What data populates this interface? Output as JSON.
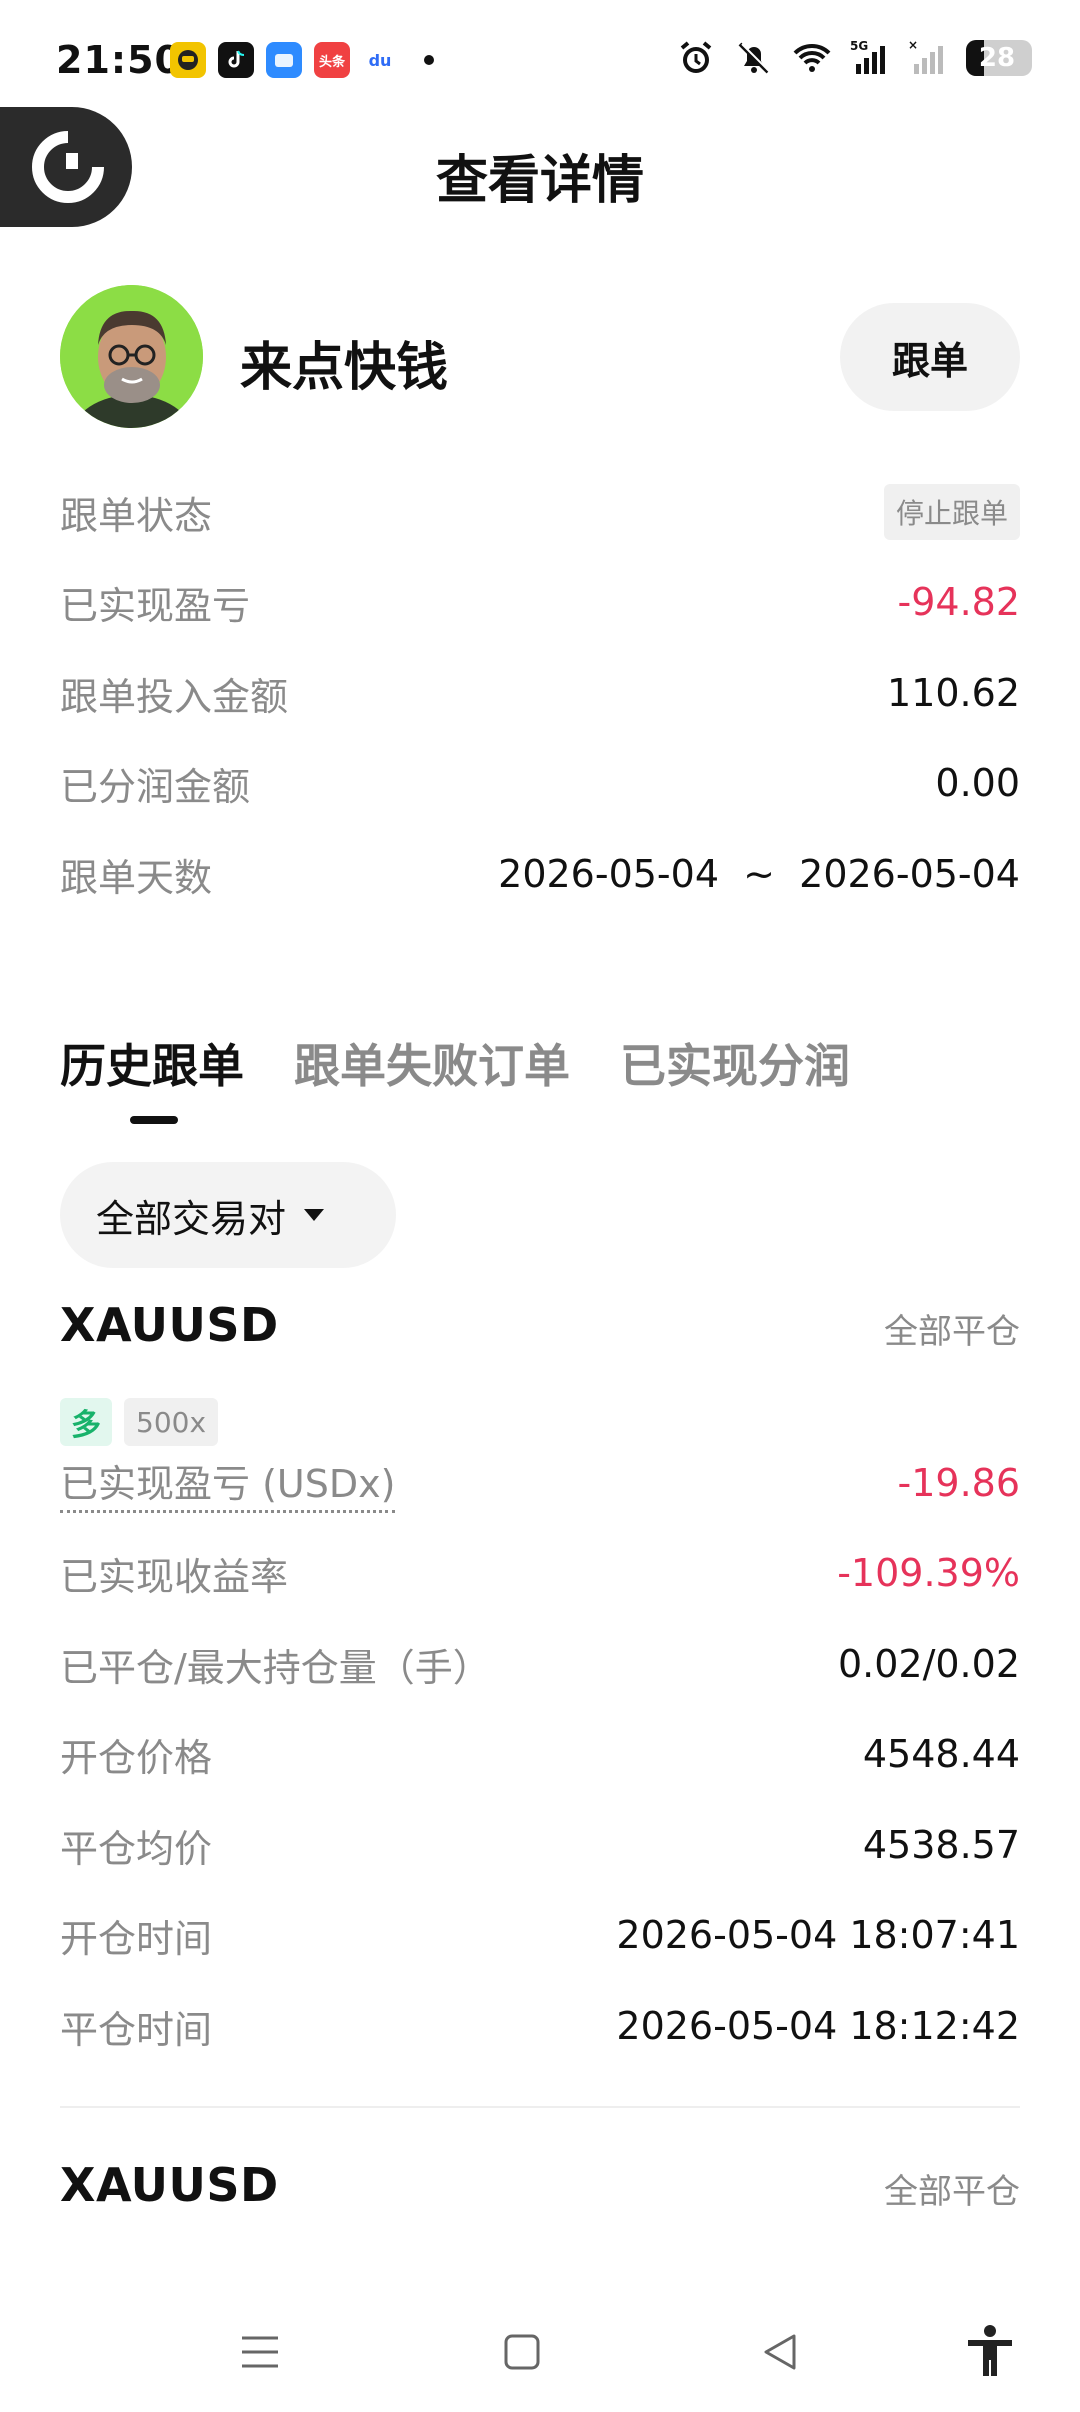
{
  "status_bar": {
    "time": "21:50",
    "battery": "28",
    "battery_level": 0.28,
    "network": "5G",
    "app_badges": [
      {
        "name": "taxi-app-icon",
        "text": "",
        "color": "#f2c400"
      },
      {
        "name": "tiktok-icon",
        "text": "",
        "color": "#111111"
      },
      {
        "name": "files-app-icon",
        "text": "",
        "color": "#2e8bff"
      },
      {
        "name": "toutiao-icon",
        "text": "头条",
        "color": "#f04142"
      },
      {
        "name": "baidu-icon",
        "text": "du",
        "color": "#2f6cf6"
      }
    ]
  },
  "header": {
    "title": "查看详情"
  },
  "profile": {
    "name": "来点快钱",
    "follow_button": "跟单"
  },
  "summary": [
    {
      "label": "跟单状态",
      "value": "停止跟单",
      "type": "tag"
    },
    {
      "label": "已实现盈亏",
      "value": "-94.82",
      "type": "negative"
    },
    {
      "label": "跟单投入金额",
      "value": "110.62",
      "type": "normal"
    },
    {
      "label": "已分润金额",
      "value": "0.00",
      "type": "normal"
    },
    {
      "label": "跟单天数",
      "value": "2026-05-04  ~  2026-05-04",
      "type": "normal"
    }
  ],
  "tabs": [
    {
      "label": "历史跟单",
      "active": true
    },
    {
      "label": "跟单失败订单",
      "active": false
    },
    {
      "label": "已实现分润",
      "active": false
    }
  ],
  "filter": {
    "label": "全部交易对"
  },
  "orders": [
    {
      "symbol": "XAUUSD",
      "status": "全部平仓",
      "direction": "多",
      "leverage": "500x",
      "fields": [
        {
          "label": "已实现盈亏 (USDx)",
          "value": "-19.86",
          "type": "negative",
          "dotted": true
        },
        {
          "label": "已实现收益率",
          "value": "-109.39%",
          "type": "negative"
        },
        {
          "label": "已平仓/最大持仓量（手）",
          "value": "0.02/0.02",
          "type": "normal"
        },
        {
          "label": "开仓价格",
          "value": "4548.44",
          "type": "normal"
        },
        {
          "label": "平仓均价",
          "value": "4538.57",
          "type": "normal"
        },
        {
          "label": "开仓时间",
          "value": "2026-05-04 18:07:41",
          "type": "normal"
        },
        {
          "label": "平仓时间",
          "value": "2026-05-04 18:12:42",
          "type": "normal"
        }
      ]
    },
    {
      "symbol": "XAUUSD",
      "status": "全部平仓"
    }
  ],
  "colors": {
    "negative": "#e6335a",
    "long_green": "#18b26b",
    "avatar_bg": "#8cdd45"
  }
}
